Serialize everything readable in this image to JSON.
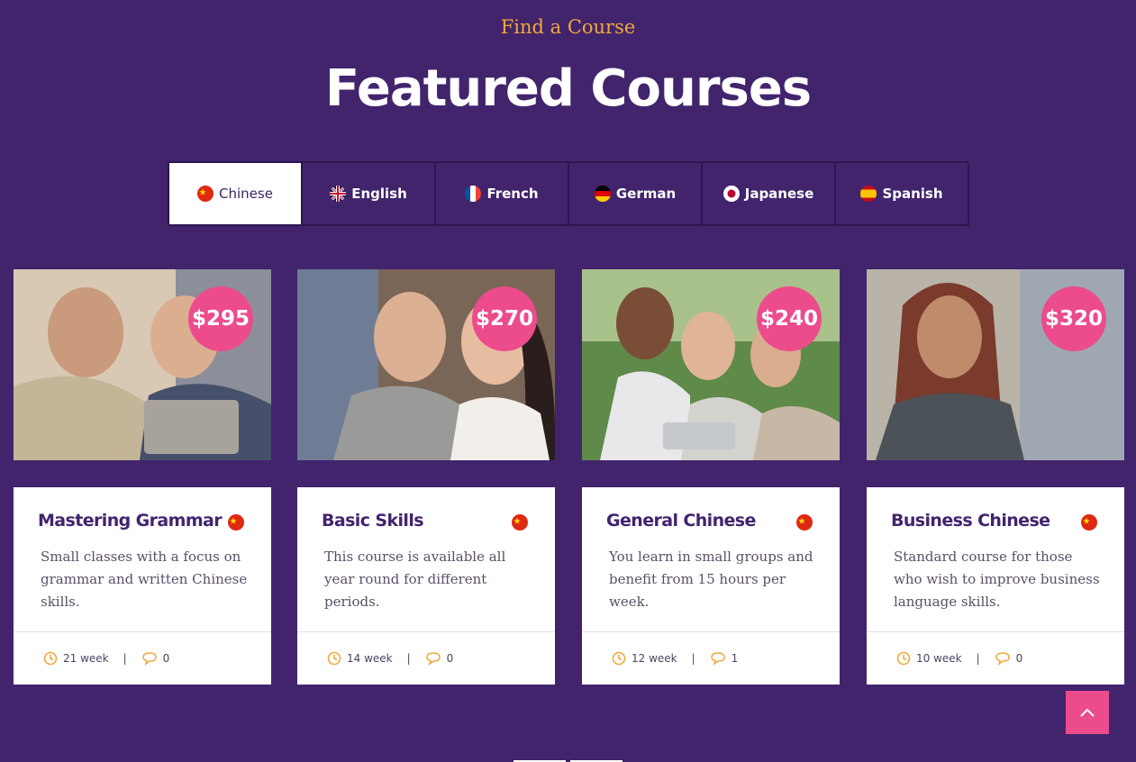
{
  "section": {
    "eyebrow": "Find a Course",
    "title": "Featured Courses"
  },
  "tabs": [
    {
      "label": "Chinese",
      "flag": "china-flag",
      "active": true
    },
    {
      "label": "English",
      "flag": "uk-flag",
      "active": false
    },
    {
      "label": "French",
      "flag": "france-flag",
      "active": false
    },
    {
      "label": "German",
      "flag": "germany-flag",
      "active": false
    },
    {
      "label": "Japanese",
      "flag": "japan-flag",
      "active": false
    },
    {
      "label": "Spanish",
      "flag": "spain-flag",
      "active": false
    }
  ],
  "courses": [
    {
      "price": "$295",
      "title": "Mastering Grammar",
      "description": "Small classes with a focus on grammar and written Chinese skills.",
      "duration": "21 week",
      "comments": "0",
      "flag": "china-flag"
    },
    {
      "price": "$270",
      "title": "Basic Skills",
      "description": "This course is available all year round for different periods.",
      "duration": "14 week",
      "comments": "0",
      "flag": "china-flag"
    },
    {
      "price": "$240",
      "title": "General Chinese",
      "description": "You learn in small groups and benefit from 15 hours per week.",
      "duration": "12 week",
      "comments": "1",
      "flag": "china-flag"
    },
    {
      "price": "$320",
      "title": "Business Chinese",
      "description": "Standard course for those who wish to improve business language skills.",
      "duration": "10 week",
      "comments": "0",
      "flag": "china-flag"
    }
  ],
  "colors": {
    "background": "#42246d",
    "accent": "#ec4c8c",
    "eyebrow": "#f0a93b",
    "icon": "#f0a93b"
  },
  "icons": {
    "duration": "clock-icon",
    "comments": "comment-icon",
    "scroll_top": "chevron-up-icon"
  }
}
